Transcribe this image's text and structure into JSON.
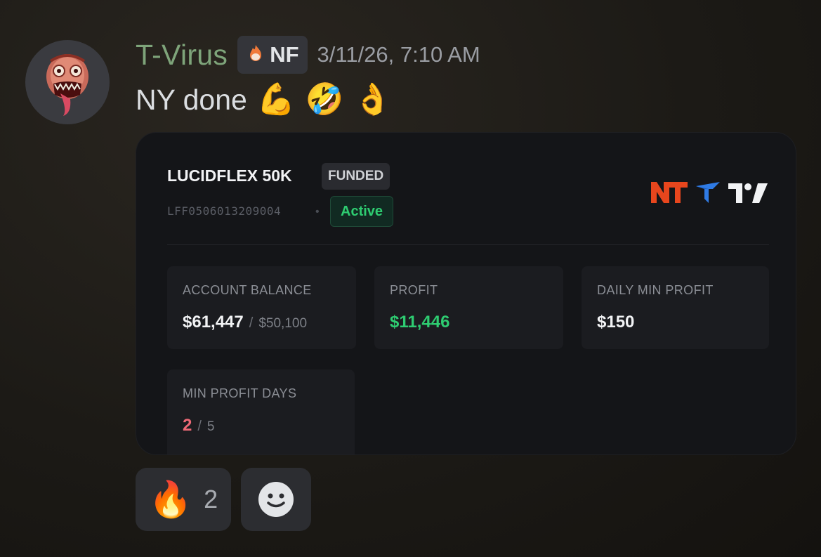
{
  "message": {
    "username": "T-Virus",
    "tag": {
      "icon": "fire-hand-icon",
      "label": "NF"
    },
    "timestamp": "3/11/26, 7:10 AM",
    "text": "NY done",
    "emojis": [
      "💪",
      "🤣",
      "👌"
    ]
  },
  "card": {
    "account_name": "LUCIDFLEX 50K",
    "funded_badge": "FUNDED",
    "account_id": "LFF0506013209004",
    "separator": "•",
    "status": "Active",
    "logos": [
      "ninjatrader-logo-icon",
      "tradovate-logo-icon",
      "tradingview-logo-icon"
    ],
    "stats": {
      "balance": {
        "label": "ACCOUNT BALANCE",
        "value": "$61,447",
        "sep": "/",
        "target": "$50,100"
      },
      "profit": {
        "label": "PROFIT",
        "value": "$11,446"
      },
      "daily_min": {
        "label": "DAILY MIN PROFIT",
        "value": "$150"
      },
      "min_days": {
        "label": "MIN PROFIT DAYS",
        "value": "2",
        "sep": "/",
        "target": "5"
      }
    }
  },
  "reactions": {
    "fire": {
      "emoji": "🔥",
      "count": "2"
    },
    "add": {
      "icon": "add-reaction-smiley-icon"
    }
  },
  "colors": {
    "username": "#7ea47a",
    "profit_green": "#2ecc71",
    "days_red": "#f06a77",
    "ninjatrader_orange": "#e8461d",
    "tradovate_blue": "#2f7be5"
  }
}
